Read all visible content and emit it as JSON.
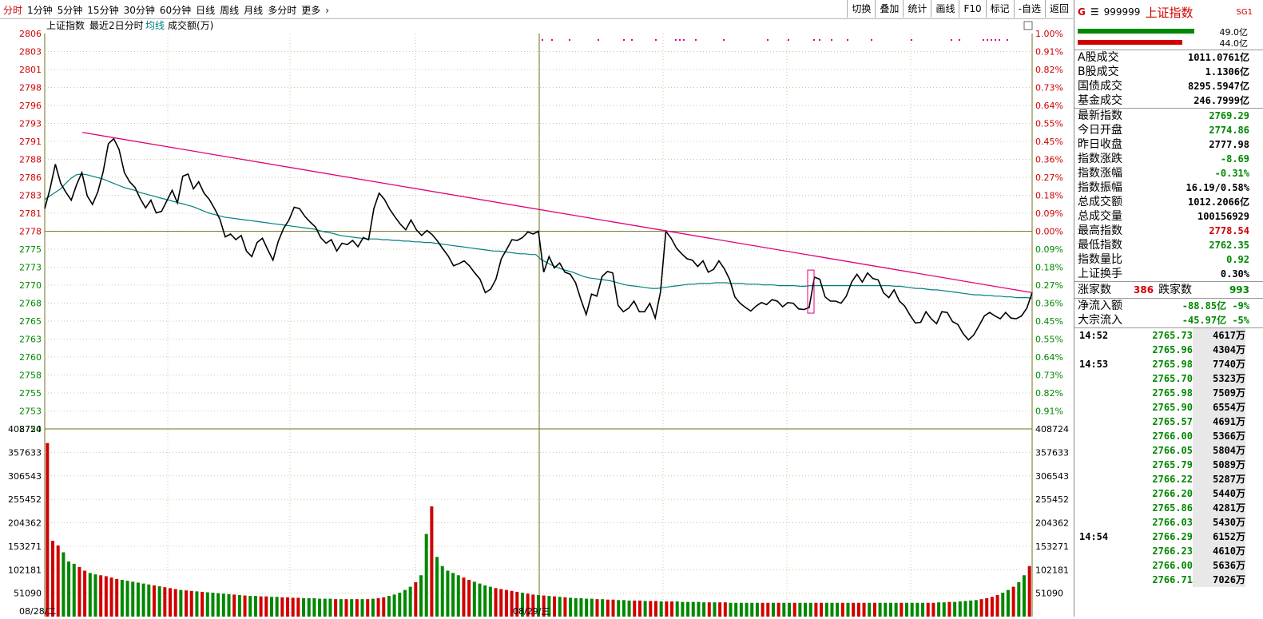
{
  "periods": [
    "分时",
    "1分钟",
    "5分钟",
    "15分钟",
    "30分钟",
    "60分钟",
    "日线",
    "周线",
    "月线",
    "多分时",
    "更多"
  ],
  "active_period": "分时",
  "more_icon": "chevron-right-icon",
  "tools": [
    "切换",
    "叠加",
    "统计",
    "画线",
    "F10",
    "标记",
    "-自选",
    "返回"
  ],
  "chart_header": {
    "title": "上证指数",
    "sub": "最近2日分时",
    "avg": "均线",
    "vol": "成交额(万)"
  },
  "left_axis": [
    "2806",
    "2803",
    "2801",
    "2798",
    "2796",
    "2793",
    "2791",
    "2788",
    "2786",
    "2783",
    "2781",
    "2778",
    "2775",
    "2773",
    "2770",
    "2768",
    "2765",
    "2763",
    "2760",
    "2758",
    "2755",
    "2753",
    "2750"
  ],
  "right_axis": [
    "1.00%",
    "0.91%",
    "0.82%",
    "0.73%",
    "0.64%",
    "0.55%",
    "0.45%",
    "0.36%",
    "0.27%",
    "0.18%",
    "0.09%",
    "0.00%",
    "0.09%",
    "0.18%",
    "0.27%",
    "0.36%",
    "0.45%",
    "0.55%",
    "0.64%",
    "0.73%",
    "0.82%",
    "0.91%"
  ],
  "vol_axis": [
    "408724",
    "357633",
    "306543",
    "255452",
    "204362",
    "153271",
    "102181",
    "51090"
  ],
  "dates": [
    "08/28/二",
    "08/29/三"
  ],
  "colors": {
    "price": "#000000",
    "avg": "#008080",
    "trend": "#e0007a",
    "up": "#d00000",
    "down": "#008800",
    "grid": "#a0a060",
    "zero": "#707020"
  },
  "price": [
    2781.2,
    2784,
    2787.5,
    2784.8,
    2783.5,
    2782.4,
    2784.6,
    2786.3,
    2783,
    2781.8,
    2783.6,
    2786.4,
    2790.4,
    2791.1,
    2789.6,
    2786.3,
    2785,
    2784.2,
    2782.6,
    2781.3,
    2782.4,
    2780.6,
    2780.8,
    2782.3,
    2783.8,
    2782,
    2785.8,
    2786.1,
    2784,
    2785,
    2783.4,
    2782.5,
    2781.2,
    2779.7,
    2777.2,
    2777.6,
    2776.8,
    2777.4,
    2775.2,
    2774.4,
    2776.4,
    2777,
    2775.4,
    2773.9,
    2776.6,
    2778.4,
    2779.6,
    2781.4,
    2781.2,
    2780.1,
    2779.3,
    2778.6,
    2777.1,
    2776.3,
    2776.8,
    2775.2,
    2776.3,
    2776.1,
    2776.7,
    2775.8,
    2777.1,
    2776.8,
    2781.2,
    2783.4,
    2782.5,
    2781.1,
    2780,
    2779,
    2778.2,
    2779.6,
    2778.2,
    2777.4,
    2778.1,
    2777.5,
    2776.6,
    2775.5,
    2774.5,
    2773.1,
    2773.4,
    2773.8,
    2773.1,
    2772.1,
    2771.2,
    2769.3,
    2769.8,
    2771.2,
    2774.1,
    2775.4,
    2776.8,
    2776.7,
    2777.1,
    2777.9,
    2777.6,
    2778,
    2772.2,
    2774.4,
    2772.8,
    2773.5,
    2772.2,
    2771.9,
    2770.7,
    2768.3,
    2766.2,
    2769.1,
    2768.8,
    2771.6,
    2772.3,
    2772.1,
    2767.5,
    2766.6,
    2767.1,
    2768.1,
    2766.6,
    2766.6,
    2767.8,
    2765.7,
    2769.4,
    2778,
    2777,
    2775.6,
    2774.8,
    2774.1,
    2773.9,
    2773,
    2773.8,
    2772.2,
    2772.6,
    2773.8,
    2772.7,
    2771.2,
    2768.7,
    2767.8,
    2767.2,
    2766.7,
    2767.4,
    2767.9,
    2767.6,
    2768.3,
    2768.1,
    2767.3,
    2767.9,
    2767.8,
    2767,
    2766.9,
    2767.2,
    2771.5,
    2771.2,
    2768.7,
    2768.1,
    2768.1,
    2767.8,
    2768.8,
    2770.8,
    2771.9,
    2770.8,
    2772.1,
    2771.3,
    2771.1,
    2769.3,
    2768.6,
    2769.7,
    2768.1,
    2767.4,
    2766.1,
    2765,
    2765.1,
    2766.6,
    2765.6,
    2764.9,
    2766.6,
    2766.5,
    2765.2,
    2764.8,
    2763.5,
    2762.6,
    2763.3,
    2764.6,
    2766,
    2766.5,
    2766,
    2765.6,
    2766.5,
    2765.7,
    2765.6,
    2766,
    2767.1,
    2769.3
  ],
  "avg": [
    2782.5,
    2783,
    2783.5,
    2784,
    2784.8,
    2785.5,
    2786,
    2786.1,
    2786,
    2785.8,
    2785.6,
    2785.4,
    2785.1,
    2784.8,
    2784.5,
    2784.2,
    2784,
    2783.8,
    2783.5,
    2783.3,
    2783.1,
    2782.9,
    2782.7,
    2782.5,
    2782.3,
    2782.1,
    2781.9,
    2781.7,
    2781.5,
    2781.2,
    2780.9,
    2780.6,
    2780.4,
    2780.2,
    2780,
    2779.9,
    2779.8,
    2779.7,
    2779.6,
    2779.5,
    2779.4,
    2779.3,
    2779.2,
    2779.1,
    2779,
    2778.9,
    2778.8,
    2778.7,
    2778.6,
    2778.5,
    2778.4,
    2778.3,
    2778.1,
    2777.9,
    2777.8,
    2777.6,
    2777.4,
    2777.3,
    2777.2,
    2777.1,
    2777,
    2776.9,
    2776.9,
    2776.9,
    2776.8,
    2776.8,
    2776.7,
    2776.7,
    2776.6,
    2776.6,
    2776.5,
    2776.5,
    2776.4,
    2776.4,
    2776.3,
    2776.2,
    2776.1,
    2776,
    2775.9,
    2775.8,
    2775.7,
    2775.6,
    2775.5,
    2775.4,
    2775.3,
    2775.2,
    2775.2,
    2775.1,
    2775,
    2774.9,
    2774.8,
    2774.8,
    2774.7,
    2774.7,
    2774,
    2773.6,
    2773.2,
    2772.9,
    2772.6,
    2772.4,
    2772.2,
    2771.9,
    2771.6,
    2771.4,
    2771.3,
    2771.2,
    2771.1,
    2771,
    2770.8,
    2770.6,
    2770.4,
    2770.3,
    2770.2,
    2770.1,
    2770,
    2769.9,
    2769.9,
    2770,
    2770.1,
    2770.2,
    2770.3,
    2770.4,
    2770.5,
    2770.5,
    2770.6,
    2770.6,
    2770.6,
    2770.7,
    2770.7,
    2770.7,
    2770.6,
    2770.6,
    2770.6,
    2770.5,
    2770.5,
    2770.5,
    2770.4,
    2770.4,
    2770.4,
    2770.3,
    2770.3,
    2770.3,
    2770.3,
    2770.2,
    2770.2,
    2770.3,
    2770.3,
    2770.3,
    2770.3,
    2770.3,
    2770.3,
    2770.3,
    2770.3,
    2770.3,
    2770.3,
    2770.3,
    2770.3,
    2770.3,
    2770.3,
    2770.3,
    2770.3,
    2770.2,
    2770.2,
    2770.1,
    2770,
    2769.9,
    2769.9,
    2769.8,
    2769.7,
    2769.7,
    2769.6,
    2769.5,
    2769.4,
    2769.3,
    2769.2,
    2769.1,
    2769,
    2769,
    2768.9,
    2768.9,
    2768.8,
    2768.8,
    2768.7,
    2768.7,
    2768.6,
    2768.6,
    2768.6,
    2768.5
  ],
  "volume": [
    378000,
    165000,
    155000,
    140000,
    120000,
    115000,
    108000,
    100000,
    95000,
    92000,
    90000,
    88000,
    85000,
    82000,
    80000,
    78000,
    76000,
    74000,
    72000,
    70000,
    68000,
    66000,
    64000,
    62000,
    60000,
    58000,
    57000,
    56000,
    55000,
    54000,
    53000,
    52000,
    51000,
    50000,
    49000,
    48000,
    47000,
    46000,
    45000,
    45000,
    44000,
    44000,
    43000,
    43000,
    42000,
    42000,
    41000,
    41000,
    40000,
    40000,
    40000,
    39000,
    39000,
    39000,
    38000,
    38000,
    38000,
    38000,
    38000,
    38000,
    38000,
    39000,
    40000,
    42000,
    45000,
    48000,
    52000,
    58000,
    65000,
    75000,
    90000,
    180000,
    240000,
    130000,
    110000,
    100000,
    95000,
    90000,
    85000,
    80000,
    76000,
    72000,
    68000,
    65000,
    62000,
    60000,
    58000,
    56000,
    54000,
    52000,
    50000,
    48000,
    47000,
    46000,
    45000,
    44000,
    43000,
    42000,
    41000,
    40000,
    40000,
    39000,
    39000,
    38000,
    38000,
    37000,
    37000,
    36000,
    36000,
    35000,
    35000,
    35000,
    34000,
    34000,
    34000,
    33000,
    33000,
    33000,
    33000,
    32000,
    32000,
    32000,
    32000,
    31000,
    31000,
    31000,
    31000,
    31000,
    30000,
    30000,
    30000,
    30000,
    30000,
    30000,
    30000,
    30000,
    30000,
    30000,
    30000,
    30000,
    30000,
    30000,
    30000,
    30000,
    30000,
    30000,
    30000,
    30000,
    30000,
    30000,
    30000,
    30000,
    30000,
    30000,
    30000,
    30000,
    30000,
    30000,
    30000,
    30000,
    30000,
    30000,
    30000,
    30000,
    30000,
    30000,
    30000,
    31000,
    31000,
    32000,
    32000,
    33000,
    34000,
    35000,
    36000,
    38000,
    40000,
    43000,
    47000,
    52000,
    58000,
    65000,
    75000,
    90000,
    110000
  ],
  "stock": {
    "g": "G",
    "code": "999999",
    "name": "上证指数",
    "tag": "SG1"
  },
  "bars": [
    {
      "label": "49.0亿",
      "color": "#008800",
      "frac": 1.0
    },
    {
      "label": "44.0亿",
      "color": "#d00000",
      "frac": 0.9
    }
  ],
  "turnover": [
    {
      "k": "A股成交",
      "v": "1011.0761亿"
    },
    {
      "k": "B股成交",
      "v": "1.1306亿"
    },
    {
      "k": "国债成交",
      "v": "8295.5947亿"
    },
    {
      "k": "基金成交",
      "v": "246.7999亿"
    }
  ],
  "stats": [
    {
      "k": "最新指数",
      "v": "2769.29",
      "c": "dn"
    },
    {
      "k": "今日开盘",
      "v": "2774.86",
      "c": "dn"
    },
    {
      "k": "昨日收盘",
      "v": "2777.98",
      "c": ""
    },
    {
      "k": "指数涨跌",
      "v": "-8.69",
      "c": "dn"
    },
    {
      "k": "指数涨幅",
      "v": "-0.31%",
      "c": "dn"
    },
    {
      "k": "指数振幅",
      "v": "16.19/0.58%",
      "c": ""
    },
    {
      "k": "总成交额",
      "v": "1012.2066亿",
      "c": ""
    },
    {
      "k": "总成交量",
      "v": "100156929",
      "c": ""
    },
    {
      "k": "最高指数",
      "v": "2778.54",
      "c": "up"
    },
    {
      "k": "最低指数",
      "v": "2762.35",
      "c": "dn"
    },
    {
      "k": "指数量比",
      "v": "0.92",
      "c": "dn"
    },
    {
      "k": "上证换手",
      "v": "0.30%",
      "c": ""
    }
  ],
  "zd": {
    "up_label": "涨家数",
    "up": "386",
    "down_label": "跌家数",
    "down": "993"
  },
  "flows": [
    {
      "k": "净流入额",
      "v": "-88.85亿 -9%"
    },
    {
      "k": "大宗流入",
      "v": "-45.97亿 -5%"
    }
  ],
  "ticks": [
    {
      "t": "14:52",
      "p": "2765.73",
      "v": "4617万"
    },
    {
      "t": "",
      "p": "2765.96",
      "v": "4304万"
    },
    {
      "t": "14:53",
      "p": "2765.98",
      "v": "7740万"
    },
    {
      "t": "",
      "p": "2765.70",
      "v": "5323万"
    },
    {
      "t": "",
      "p": "2765.98",
      "v": "7509万"
    },
    {
      "t": "",
      "p": "2765.90",
      "v": "6554万"
    },
    {
      "t": "",
      "p": "2765.57",
      "v": "4691万"
    },
    {
      "t": "",
      "p": "2766.00",
      "v": "5366万"
    },
    {
      "t": "",
      "p": "2766.05",
      "v": "5804万"
    },
    {
      "t": "",
      "p": "2765.79",
      "v": "5089万"
    },
    {
      "t": "",
      "p": "2766.22",
      "v": "5287万"
    },
    {
      "t": "",
      "p": "2766.20",
      "v": "5440万"
    },
    {
      "t": "",
      "p": "2765.86",
      "v": "4281万"
    },
    {
      "t": "",
      "p": "2766.03",
      "v": "5430万"
    },
    {
      "t": "14:54",
      "p": "2766.29",
      "v": "6152万"
    },
    {
      "t": "",
      "p": "2766.23",
      "v": "4610万"
    },
    {
      "t": "",
      "p": "2766.00",
      "v": "5636万"
    },
    {
      "t": "",
      "p": "2766.71",
      "v": "7026万"
    }
  ]
}
